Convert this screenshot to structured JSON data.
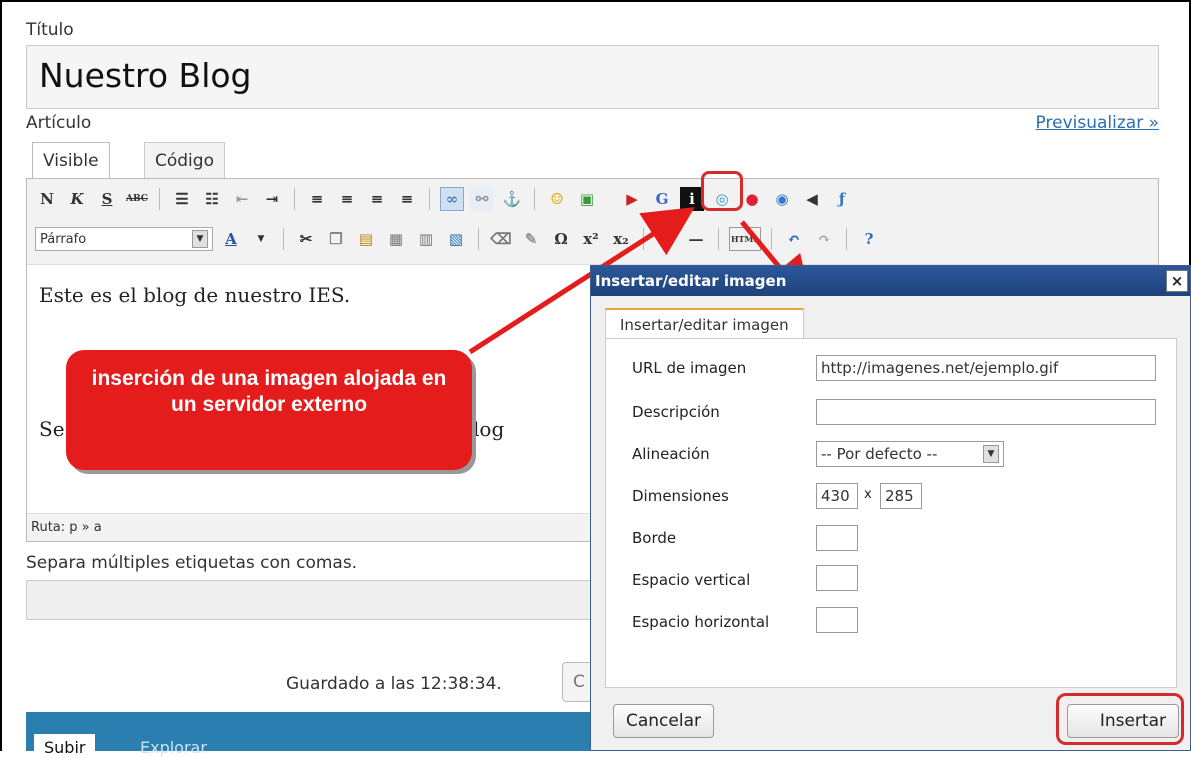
{
  "post": {
    "title_label": "Título",
    "title_value": "Nuestro Blog",
    "article_label": "Artículo",
    "preview_link": "Previsualizar »",
    "tabs": [
      {
        "label": "Visible"
      },
      {
        "label": "Código"
      }
    ]
  },
  "toolbar": {
    "bold": "N",
    "italic": "K",
    "underline": "S",
    "strike": "ABC",
    "format_select": "Párrafo",
    "text_color": "A",
    "special_char": "Ω",
    "html": "HTML"
  },
  "editor": {
    "line1": "Este es el blog de nuestro IES.",
    "line2_start": "Se",
    "line2_end": "log",
    "path": "Ruta: p » a"
  },
  "tags": {
    "label": "Separa múltiples etiquetas con comas."
  },
  "status": {
    "saved_text": "Guardado a las 12:38:34.",
    "saved_button": "C"
  },
  "upload": {
    "tabs": [
      {
        "label": "Subir"
      },
      {
        "label": "Explorar"
      }
    ]
  },
  "callout": {
    "text": "inserción de una imagen alojada en un servidor externo"
  },
  "dialog": {
    "title": "Insertar/editar imagen",
    "close": "×",
    "tab": "Insertar/editar imagen",
    "fields": {
      "url_label": "URL de imagen",
      "url_value": "http://imagenes.net/ejemplo.gif",
      "desc_label": "Descripción",
      "align_label": "Alineación",
      "align_value": "-- Por defecto --",
      "dims_label": "Dimensiones",
      "width": "430",
      "x": "x",
      "height": "285",
      "border_label": "Borde",
      "vspace_label": "Espacio vertical",
      "hspace_label": "Espacio horizontal"
    },
    "cancel": "Cancelar",
    "insert": "Insertar"
  },
  "colors": {
    "accent_red": "#e51c1c",
    "dialog_title": "#2b579a",
    "upload_bar": "#2a7eb0"
  }
}
